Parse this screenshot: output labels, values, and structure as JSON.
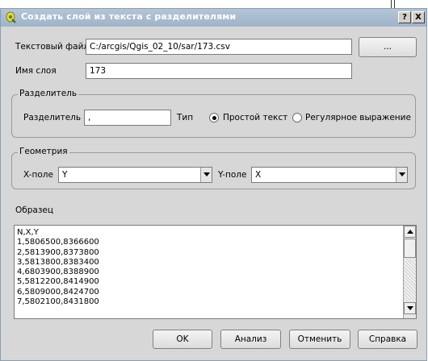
{
  "window": {
    "title": "Создать слой из текста с разделителями",
    "help_label": "?",
    "close_label": "X"
  },
  "file": {
    "label": "Текстовый файл",
    "value": "C:/arcgis/Qgis_02_10/sar/173.csv",
    "browse_label": "..."
  },
  "layer": {
    "label": "Имя слоя",
    "value": "173"
  },
  "delimiter_group": {
    "title": "Разделитель",
    "delimiter_label": "Разделитель",
    "delimiter_value": ",",
    "type_label": "Тип",
    "option_plain": "Простой текст",
    "option_regex": "Регулярное выражение"
  },
  "geometry_group": {
    "title": "Геометрия",
    "x_label": "X-поле",
    "x_value": "Y",
    "y_label": "Y-поле",
    "y_value": "X"
  },
  "sample": {
    "label": "Образец",
    "lines": [
      "N,X,Y",
      "1,5806500,8366600",
      "2,5813900,8373800",
      "3,5813800,8383400",
      "4,6803900,8388900",
      "5,5812200,8414900",
      "6,5809000,8424700",
      "7,5802100,8431800"
    ]
  },
  "buttons": {
    "ok": "OK",
    "analyze": "Анализ",
    "cancel": "Отменить",
    "help": "Справка"
  }
}
